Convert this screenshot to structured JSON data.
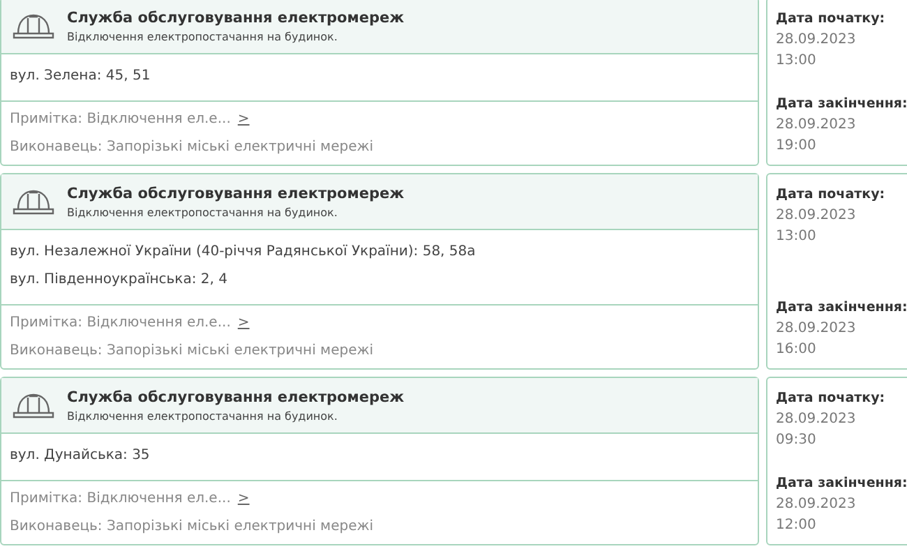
{
  "outages": [
    {
      "service": "Служба обслуговування електромереж",
      "description": "Відключення електропостачання на будинок.",
      "addresses": [
        "вул. Зелена: 45, 51"
      ],
      "note": "Примітка: Відключення ел.е...",
      "note_link": ">",
      "executor": "Виконавець: Запорізькі міські електричні мережі",
      "start_label": "Дата початку:",
      "start_date": "28.09.2023",
      "start_time": "13:00",
      "end_label": "Дата закінчення:",
      "end_date": "28.09.2023",
      "end_time": "19:00"
    },
    {
      "service": "Служба обслуговування електромереж",
      "description": "Відключення електропостачання на будинок.",
      "addresses": [
        "вул. Незалежної України (40-річчя Радянської України): 58, 58а",
        "вул. Південноукраїнська: 2, 4"
      ],
      "note": "Примітка: Відключення ел.е...",
      "note_link": ">",
      "executor": "Виконавець: Запорізькі міські електричні мережі",
      "start_label": "Дата початку:",
      "start_date": "28.09.2023",
      "start_time": "13:00",
      "end_label": "Дата закінчення:",
      "end_date": "28.09.2023",
      "end_time": "16:00"
    },
    {
      "service": "Служба обслуговування електромереж",
      "description": "Відключення електропостачання на будинок.",
      "addresses": [
        "вул. Дунайська: 35"
      ],
      "note": "Примітка: Відключення ел.е...",
      "note_link": ">",
      "executor": "Виконавець: Запорізькі міські електричні мережі",
      "start_label": "Дата початку:",
      "start_date": "28.09.2023",
      "start_time": "09:30",
      "end_label": "Дата закінчення:",
      "end_date": "28.09.2023",
      "end_time": "12:00"
    }
  ]
}
